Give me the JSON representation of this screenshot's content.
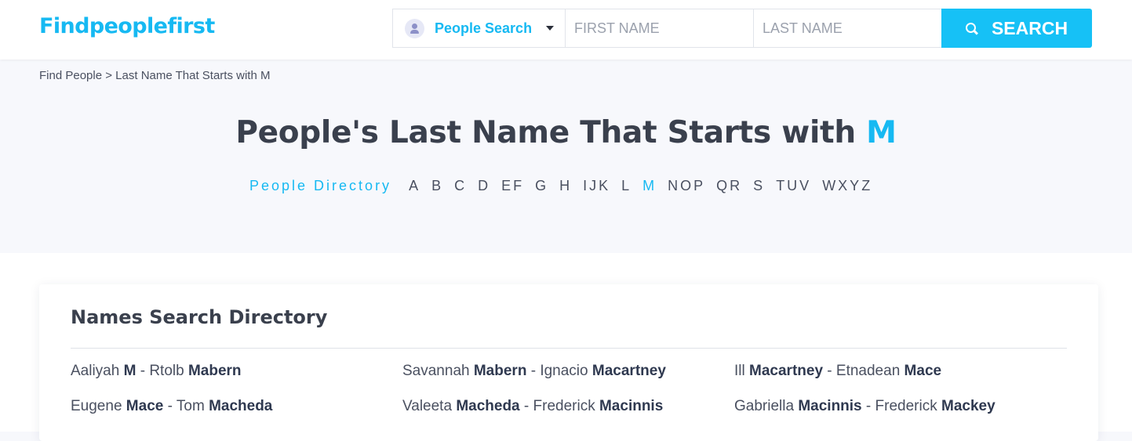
{
  "header": {
    "logo": "Findpeoplefirst",
    "search_type": "People Search",
    "first_name_placeholder": "FIRST NAME",
    "last_name_placeholder": "LAST NAME",
    "search_label": "SEARCH"
  },
  "breadcrumb": {
    "home": "Find People",
    "separator": " > ",
    "current": "Last Name That Starts with M"
  },
  "hero": {
    "title_prefix": "People's Last Name That Starts with ",
    "title_letter": "M"
  },
  "alphabet": {
    "directory_label": "People Directory",
    "letters": [
      "A",
      "B",
      "C",
      "D",
      "EF",
      "G",
      "H",
      "IJK",
      "L",
      "M",
      "NOP",
      "QR",
      "S",
      "TUV",
      "WXYZ"
    ],
    "active": "M"
  },
  "directory": {
    "title": "Names Search Directory",
    "rows": [
      [
        {
          "first_a": "Aaliyah",
          "last_a": "M",
          "first_b": "Rtolb",
          "last_b": "Mabern"
        },
        {
          "first_a": "Savannah",
          "last_a": "Mabern",
          "first_b": "Ignacio",
          "last_b": "Macartney"
        },
        {
          "first_a": "Ill",
          "last_a": "Macartney",
          "first_b": "Etnadean",
          "last_b": "Mace"
        }
      ],
      [
        {
          "first_a": "Eugene",
          "last_a": "Mace",
          "first_b": "Tom",
          "last_b": "Macheda"
        },
        {
          "first_a": "Valeeta",
          "last_a": "Macheda",
          "first_b": "Frederick",
          "last_b": "Macinnis"
        },
        {
          "first_a": "Gabriella",
          "last_a": "Macinnis",
          "first_b": "Frederick",
          "last_b": "Mackey"
        }
      ]
    ],
    "dash": " - "
  },
  "colors": {
    "accent": "#16b9f2",
    "button": "#16c1f6",
    "text": "#3a404d",
    "page_bg": "#f7f8fc"
  },
  "icons": [
    "person-icon",
    "chevron-down-icon",
    "search-icon"
  ]
}
